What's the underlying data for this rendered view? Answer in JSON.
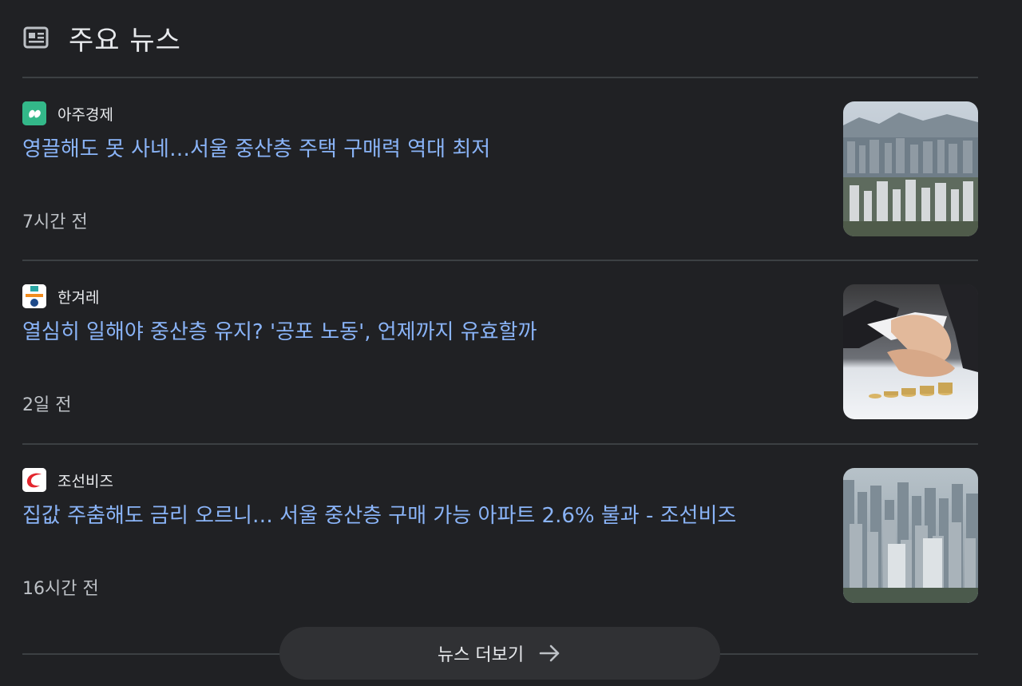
{
  "header": {
    "title": "주요 뉴스",
    "icon": "newspaper-icon"
  },
  "articles": [
    {
      "source": "아주경제",
      "source_logo": "ajunews-logo",
      "headline": "영끌해도 못 사네…서울 중산층 주택 구매력 역대 최저",
      "time": "7시간 전",
      "thumbnail": "city-skyline-image"
    },
    {
      "source": "한겨레",
      "source_logo": "hani-logo",
      "headline": "열심히 일해야 중산층 유지? '공포 노동', 언제까지 유효할까",
      "time": "2일 전",
      "thumbnail": "hand-stacking-coins-image"
    },
    {
      "source": "조선비즈",
      "source_logo": "chosunbiz-logo",
      "headline": "집값 주춤해도 금리 오르니… 서울 중산층 구매 가능 아파트 2.6% 불과 - 조선비즈",
      "time": "16시간 전",
      "thumbnail": "apartment-towers-image"
    }
  ],
  "more_button": {
    "label": "뉴스 더보기",
    "icon": "arrow-right-icon"
  },
  "colors": {
    "background": "#202124",
    "headline": "#8ab4f8",
    "text": "#e8eaed",
    "secondary_text": "#bdc1c6",
    "divider": "#3c4043",
    "button_bg": "#303134"
  }
}
